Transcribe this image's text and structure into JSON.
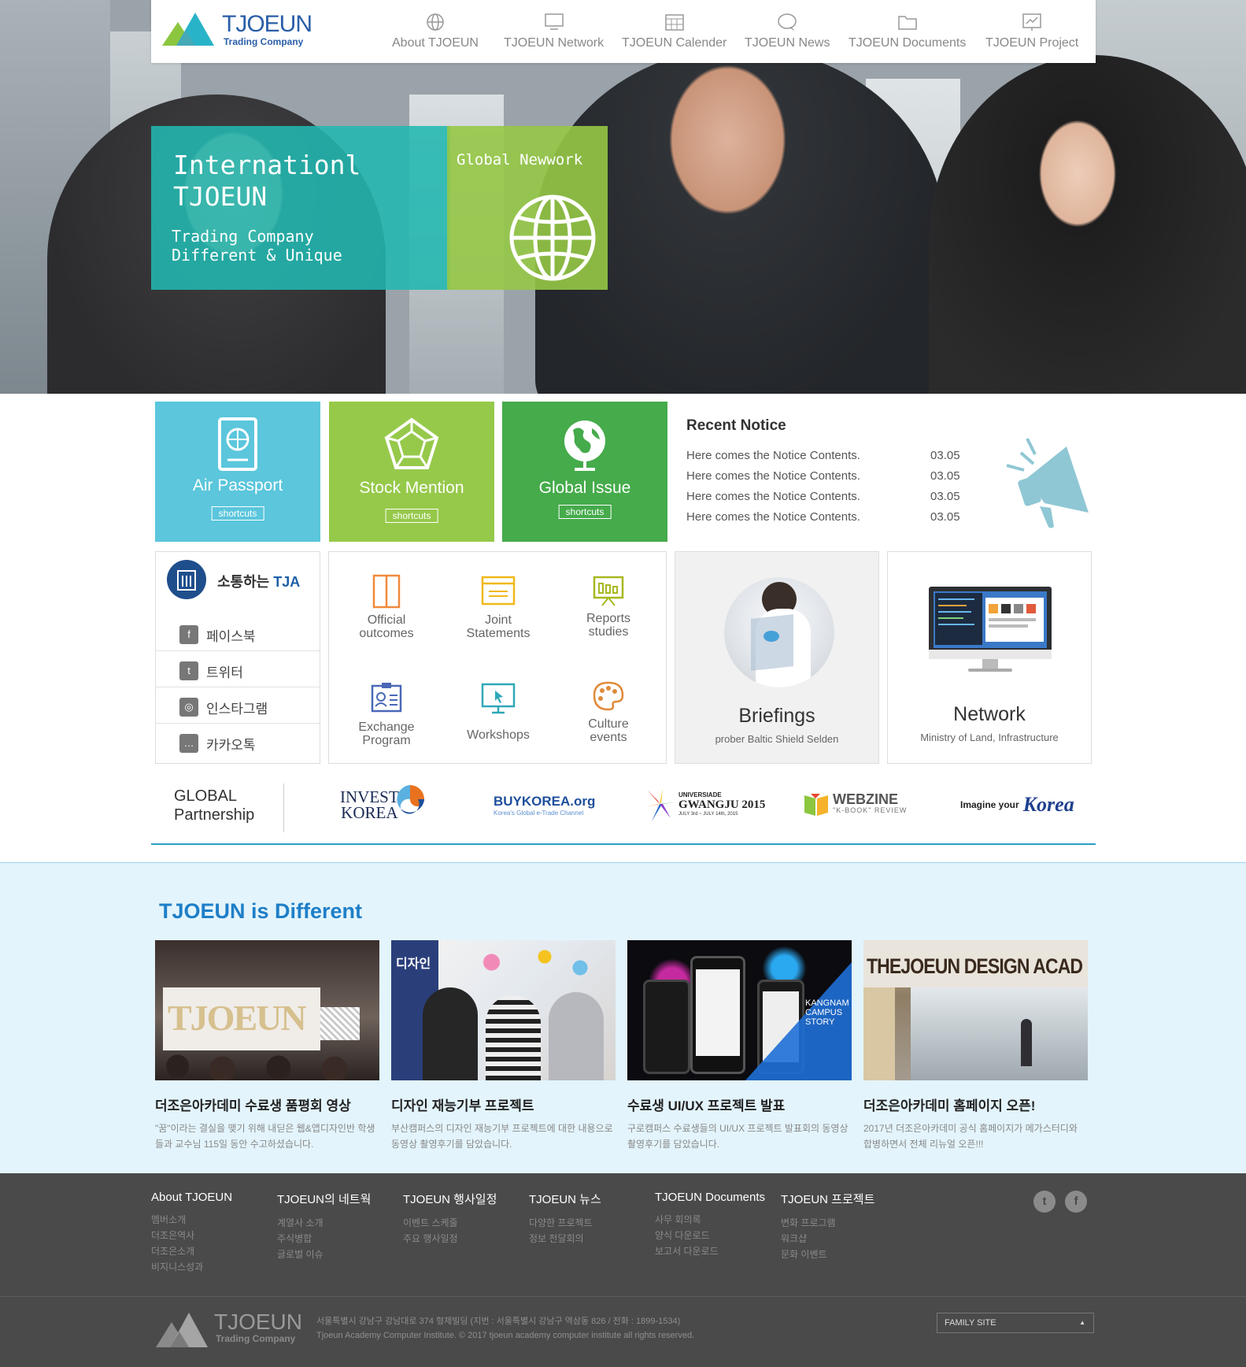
{
  "brand": {
    "name": "TJOEUN",
    "sub": "Trading Company"
  },
  "nav": [
    {
      "label": "About  TJOEUN",
      "icon": "globe-icon"
    },
    {
      "label": "TJOEUN  Network",
      "icon": "monitor-icon"
    },
    {
      "label": "TJOEUN  Calender",
      "icon": "calendar-icon"
    },
    {
      "label": "TJOEUN  News",
      "icon": "chat-icon"
    },
    {
      "label": "TJOEUN  Documents",
      "icon": "folder-icon"
    },
    {
      "label": "TJOEUN  Project",
      "icon": "chart-icon"
    }
  ],
  "hero": {
    "title_line1": "Internationl",
    "title_line2": "TJOEUN",
    "sub_line1": "Trading Company",
    "sub_line2": "Different & Unique",
    "side_title": "Global Newwork"
  },
  "tiles": [
    {
      "label": "Air Passport",
      "button": "shortcuts",
      "icon": "passport-icon",
      "color": "#5bc6dc"
    },
    {
      "label": "Stock Mention",
      "button": "shortcuts",
      "icon": "pentagon-icon",
      "color": "#96c94a"
    },
    {
      "label": "Global Issue",
      "button": "shortcuts",
      "icon": "globe-icon",
      "color": "#45ab4b"
    }
  ],
  "notice": {
    "title": "Recent Notice",
    "items": [
      {
        "text": "Here comes the Notice Contents.",
        "date": "03.05"
      },
      {
        "text": "Here comes the Notice Contents.",
        "date": "03.05"
      },
      {
        "text": "Here comes the Notice Contents.",
        "date": "03.05"
      },
      {
        "text": "Here comes the Notice Contents.",
        "date": "03.05"
      }
    ]
  },
  "social": {
    "title_prefix": "소통하는",
    "title_brand": "TJA",
    "items": [
      {
        "label": "페이스북",
        "icon": "facebook-icon",
        "glyph": "f"
      },
      {
        "label": "트위터",
        "icon": "twitter-icon",
        "glyph": "t"
      },
      {
        "label": "인스타그램",
        "icon": "instagram-icon",
        "glyph": "◎"
      },
      {
        "label": "카카오톡",
        "icon": "kakaotalk-icon",
        "glyph": "…"
      }
    ]
  },
  "services": [
    {
      "line1": "Official",
      "line2": "outcomes",
      "icon": "door-icon"
    },
    {
      "line1": "Joint",
      "line2": "Statements",
      "icon": "window-icon"
    },
    {
      "line1": "Reports",
      "line2": "studies",
      "icon": "presentation-icon"
    },
    {
      "line1": "Exchange",
      "line2": "Program",
      "icon": "id-card-icon"
    },
    {
      "line1": "Workshops",
      "line2": "",
      "icon": "monitor-cursor-icon"
    },
    {
      "line1": "Culture",
      "line2": "events",
      "icon": "palette-icon"
    }
  ],
  "features": [
    {
      "title": "Briefings",
      "sub": "prober Baltic Shield Selden"
    },
    {
      "title": "Network",
      "sub": "Ministry of Land, Infrastructure"
    }
  ],
  "partners": {
    "label_line1": "GLOBAL",
    "label_line2": "Partnership",
    "logos": [
      {
        "name": "INVEST KOREA",
        "l1": "INVEST",
        "l2": "KOREA"
      },
      {
        "name": "BuyKOREA.org",
        "l1": "BUYKOREA.org",
        "l2": "Korea's Global e-Trade Channel"
      },
      {
        "name": "GWANGJU 2015",
        "l1": "UNIVERSIADE",
        "l2": "GWANGJU 2015",
        "l3": "JULY 3rd ~ JULY 14th, 2015"
      },
      {
        "name": "WEBZINE",
        "l1": "WEBZINE",
        "l2": "\"K-BOOK\" REVIEW"
      },
      {
        "name": "Imagine your Korea",
        "l1": "Imagine your",
        "l2": "Korea"
      }
    ]
  },
  "different": {
    "title": "TJOEUN is Different",
    "cards": [
      {
        "title": "더조은아카데미 수료생 품평회 영상",
        "desc": "\"꿈\"이라는 결실을 맺기 위해 내딛은 웹&앱디자인반 학생들과 교수님 115일 동안 수고하셨습니다."
      },
      {
        "title": "디자인 재능기부 프로젝트",
        "desc": "부산캠퍼스의 디자인 재능기부 프로젝트에 대한 내용으로 동영상 촬영후기를 담았습니다."
      },
      {
        "title": "수료생 UI/UX 프로젝트 발표",
        "desc": "구로캠퍼스 수료생들의 UI/UX 프로젝트 발표회의 동영상 촬영후기를 담았습니다."
      },
      {
        "title": "더조은아카데미 홈페이지 오픈!",
        "desc": "2017년 더조은아카데미 공식 홈페이지가 메가스터디와 합병하면서 전체 리뉴얼 오픈!!!"
      }
    ],
    "card_images": [
      {
        "text": "TJOEUN"
      },
      {
        "text": "디자인"
      },
      {
        "text": "KANGNAM CAMPUS STORY"
      },
      {
        "text": "THEJOEUN DESIGN ACAD"
      }
    ]
  },
  "footer": {
    "columns": [
      {
        "title": "About TJOEUN",
        "links": [
          "멤버소개",
          "더조은역사",
          "더조은소개",
          "비지니스성과"
        ]
      },
      {
        "title": "TJOEUN의 네트웍",
        "links": [
          "계열사 소개",
          "주식병합",
          "글로벌 이슈"
        ]
      },
      {
        "title": "TJOEUN 행사일정",
        "links": [
          "이벤트 스케줄",
          "주요 행사일정"
        ]
      },
      {
        "title": "TJOEUN 뉴스",
        "links": [
          "다양한 프로젝트",
          "정보 전달회의"
        ]
      },
      {
        "title": "TJOEUN Documents",
        "links": [
          "사무 회의록",
          "양식 다운로드",
          "보고서 다운로드"
        ]
      },
      {
        "title": "TJOEUN 프로젝트",
        "links": [
          "변화 프로그램",
          "워크샵",
          "문화 이벤트"
        ]
      }
    ],
    "address": "서울특별시 강남구 강남대로 374 형제빌딩 (지번 : 서울특별시 강남구 역삼동 826 / 전화 : 1899-1534)",
    "copyright": "Tjoeun Academy Computer Institute. © 2017 tjoeun academy computer institute all rights reserved.",
    "family_site": "FAMILY SITE",
    "social": [
      {
        "icon": "twitter-icon",
        "glyph": "t"
      },
      {
        "icon": "facebook-icon",
        "glyph": "f"
      }
    ]
  },
  "colors": {
    "accent": "#1e7fc8",
    "teal": "#22b7b0",
    "green": "#96c94a",
    "dark_green": "#45ab4b",
    "sky": "#5bc6dc",
    "footer": "#4a4a4a"
  }
}
